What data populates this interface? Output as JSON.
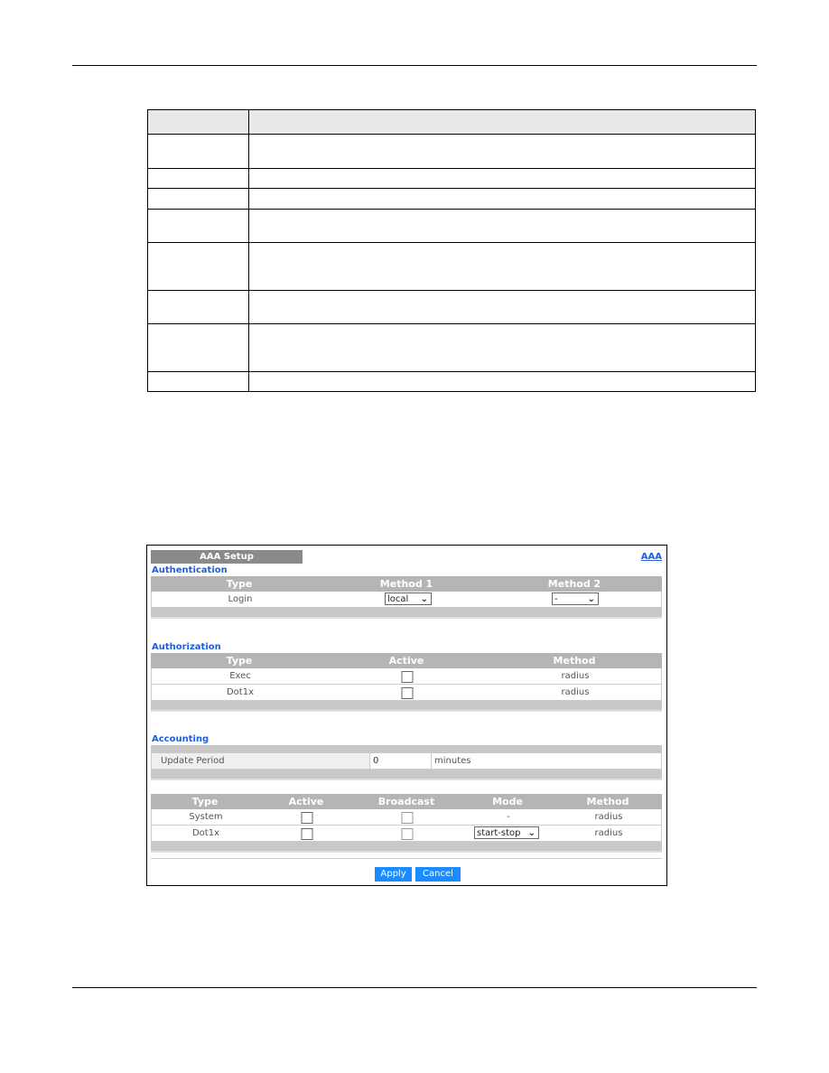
{
  "screenshot": {
    "tab_title": "AAA Setup",
    "aaa_link": "AAA",
    "authentication": {
      "label": "Authentication",
      "headers": [
        "Type",
        "Method 1",
        "Method 2"
      ],
      "rows": [
        {
          "type": "Login",
          "method1": "local",
          "method2": "-"
        }
      ]
    },
    "authorization": {
      "label": "Authorization",
      "headers": [
        "Type",
        "Active",
        "Method"
      ],
      "rows": [
        {
          "type": "Exec",
          "active": false,
          "method": "radius"
        },
        {
          "type": "Dot1x",
          "active": false,
          "method": "radius"
        }
      ]
    },
    "accounting": {
      "label": "Accounting",
      "update_period_label": "Update Period",
      "update_period_value": "0",
      "update_period_unit": "minutes",
      "headers": [
        "Type",
        "Active",
        "Broadcast",
        "Mode",
        "Method"
      ],
      "rows": [
        {
          "type": "System",
          "active": false,
          "broadcast": false,
          "mode": "-",
          "method": "radius"
        },
        {
          "type": "Dot1x",
          "active": false,
          "broadcast": false,
          "mode": "start-stop",
          "method": "radius"
        }
      ]
    },
    "apply_label": "Apply",
    "cancel_label": "Cancel",
    "colors": {
      "accent": "#1f5fd8",
      "button": "#1a8cff",
      "header_gray": "#b5b5b5"
    }
  }
}
